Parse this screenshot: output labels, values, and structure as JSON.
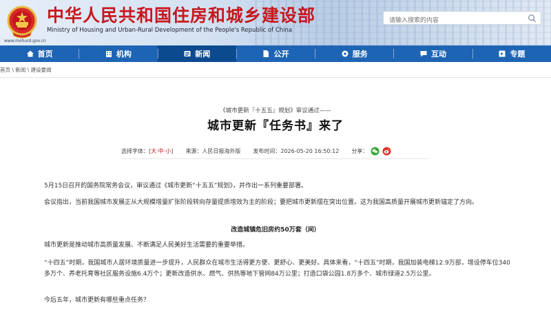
{
  "header": {
    "title": "中华人民共和国住房和城乡建设部",
    "subtitle": "Ministry of Housing and Urban-Rural Development of the People's Republic of China",
    "url": "www.mohurd.gov.cn",
    "search_placeholder": "请输入搜索的内容",
    "title_color": "#c8181e"
  },
  "nav": {
    "items": [
      {
        "label": "首页",
        "icon": "home-icon"
      },
      {
        "label": "机构",
        "icon": "building-icon"
      },
      {
        "label": "新闻",
        "icon": "news-icon",
        "active": true
      },
      {
        "label": "公开",
        "icon": "document-icon"
      },
      {
        "label": "服务",
        "icon": "gear-icon"
      },
      {
        "label": "互动",
        "icon": "chat-icon"
      },
      {
        "label": "专题",
        "icon": "topic-icon"
      }
    ],
    "bg_color": "#1e64b4"
  },
  "breadcrumb": {
    "items": [
      "首页",
      "新闻",
      "建设要闻"
    ],
    "separator": " \\ "
  },
  "article": {
    "pre_title": "《城市更新『十五五』规划》审议通过——",
    "title": "城市更新『任务书』来了",
    "font_select_label": "选择字体：[",
    "font_large": "大",
    "font_mid": "中",
    "font_small": "小",
    "font_close": "]",
    "source": "来源：人民日报海外版",
    "publish_time": "发布时间：2026-05-20 16:50:12",
    "share_label": "分享：",
    "paragraphs": [
      "5月15日召开的国务院常务会议，审议通过《城市更新“十五五”规划》，并作出一系列重要部署。",
      "会议指出，当前我国城市发展正从大规模增量扩张阶段转向存量提质增效为主的阶段；要把城市更新摆在突出位置。这为我国高质量开展城市更新锚定了方向。",
      "城市更新是推动城市高质量发展、不断满足人民美好生活需要的重要举措。",
      "“十四五”时期，我国城市人居环境质量进一步提升，人民群众在城市生活得更方便、更舒心、更美好。具体来看，“十四五”时期，我国加装电梯12.9万部，增设停车位340多万个、养老托育等社区服务设施6.4万个；更新改造供水、燃气、供热等地下管网84万公里；打造口袋公园1.8万多个、城市绿道2.5万公里。",
      "今后五年，城市更新有哪些重点任务？"
    ],
    "subheading": "改造城镇危旧房约50万套（间）"
  }
}
